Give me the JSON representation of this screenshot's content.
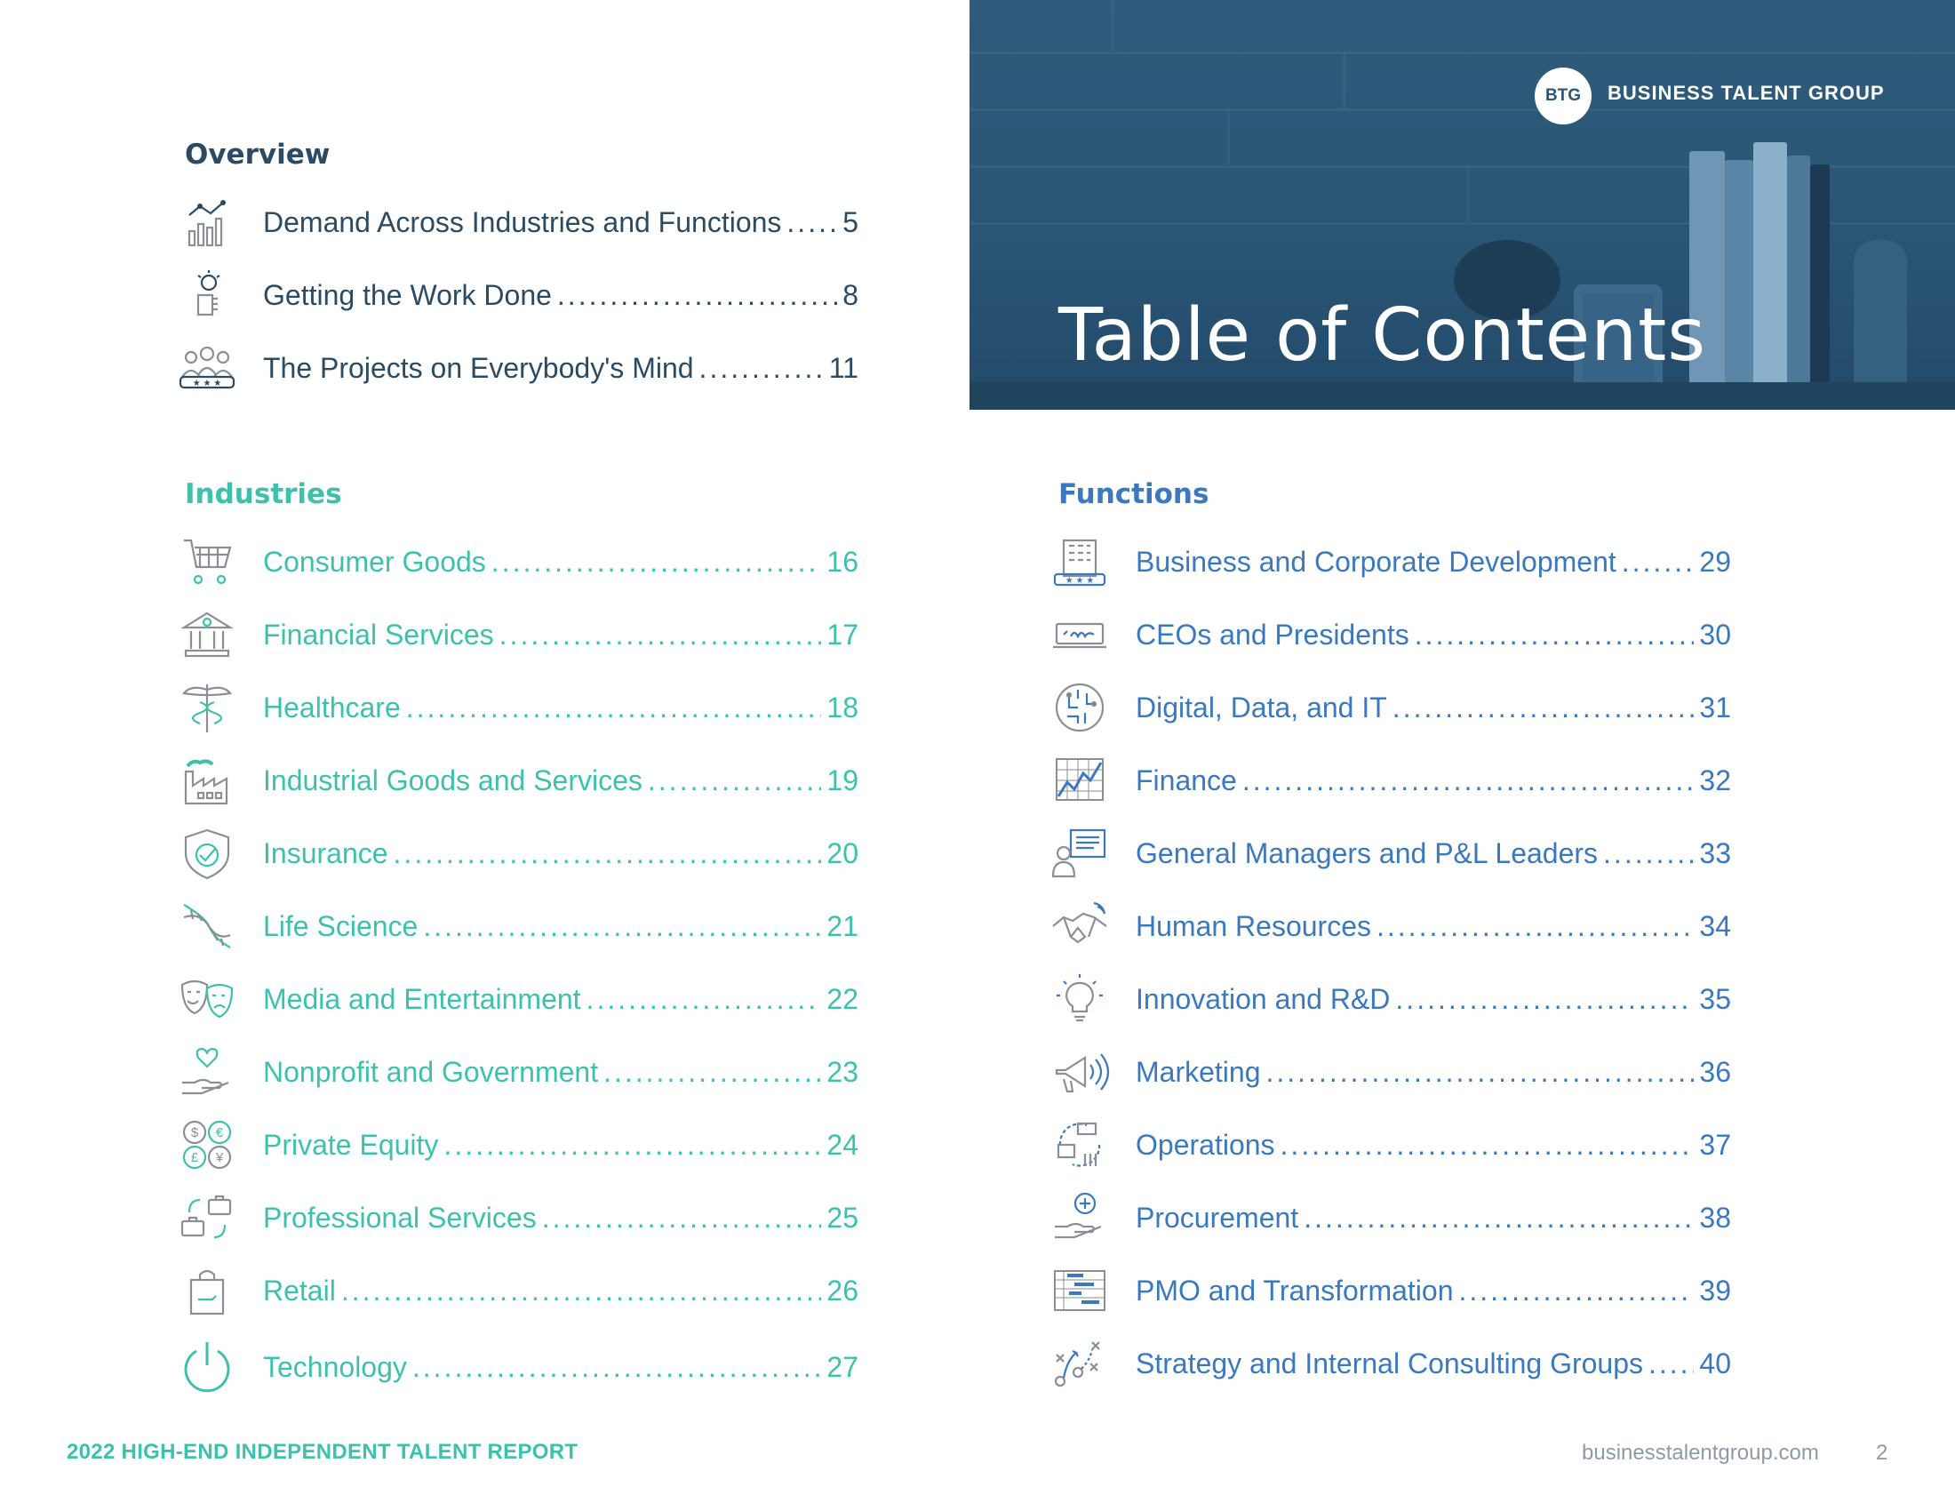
{
  "hero": {
    "title": "Table of Contents",
    "logo_text": "BTG",
    "brand_name": "BUSINESS TALENT GROUP"
  },
  "overview": {
    "heading": "Overview",
    "items": [
      {
        "label": "Demand Across Industries and Functions",
        "page": "5",
        "icon": "chart-trend-icon"
      },
      {
        "label": "Getting the Work Done",
        "page": "8",
        "icon": "hand-lightbulb-icon"
      },
      {
        "label": "The Projects on Everybody's Mind",
        "page": "11",
        "icon": "people-stars-icon"
      }
    ]
  },
  "industries": {
    "heading": "Industries",
    "items": [
      {
        "label": "Consumer Goods",
        "page": "16",
        "icon": "shopping-cart-icon"
      },
      {
        "label": "Financial Services",
        "page": "17",
        "icon": "bank-icon"
      },
      {
        "label": "Healthcare",
        "page": "18",
        "icon": "caduceus-icon"
      },
      {
        "label": "Industrial Goods and Services",
        "page": "19",
        "icon": "factory-icon"
      },
      {
        "label": "Insurance",
        "page": "20",
        "icon": "shield-check-icon"
      },
      {
        "label": "Life Science",
        "page": "21",
        "icon": "dna-icon"
      },
      {
        "label": "Media and Entertainment",
        "page": "22",
        "icon": "theater-masks-icon"
      },
      {
        "label": "Nonprofit and Government",
        "page": "23",
        "icon": "hand-heart-icon"
      },
      {
        "label": "Private Equity",
        "page": "24",
        "icon": "currencies-icon"
      },
      {
        "label": "Professional Services",
        "page": "25",
        "icon": "briefcase-exchange-icon"
      },
      {
        "label": "Retail",
        "page": "26",
        "icon": "shopping-bag-icon"
      },
      {
        "label": "Technology",
        "page": "27",
        "icon": "power-icon"
      }
    ]
  },
  "functions": {
    "heading": "Functions",
    "items": [
      {
        "label": "Business and Corporate Development",
        "page": "29",
        "icon": "building-stars-icon"
      },
      {
        "label": "CEOs and Presidents",
        "page": "30",
        "icon": "signature-icon"
      },
      {
        "label": "Digital, Data, and IT",
        "page": "31",
        "icon": "circuit-brain-icon"
      },
      {
        "label": "Finance",
        "page": "32",
        "icon": "line-chart-icon"
      },
      {
        "label": "General Managers and P&L Leaders",
        "page": "33",
        "icon": "presenter-board-icon"
      },
      {
        "label": "Human Resources",
        "page": "34",
        "icon": "handshake-icon"
      },
      {
        "label": "Innovation and R&D",
        "page": "35",
        "icon": "lightbulb-icon"
      },
      {
        "label": "Marketing",
        "page": "36",
        "icon": "megaphone-icon"
      },
      {
        "label": "Operations",
        "page": "37",
        "icon": "operations-cycle-icon"
      },
      {
        "label": "Procurement",
        "page": "38",
        "icon": "hand-plus-icon"
      },
      {
        "label": "PMO and Transformation",
        "page": "39",
        "icon": "gantt-chart-icon"
      },
      {
        "label": "Strategy and Internal Consulting Groups",
        "page": "40",
        "icon": "strategy-play-icon"
      }
    ]
  },
  "footer": {
    "report_title": "2022 HIGH-END INDEPENDENT TALENT REPORT",
    "url": "businesstalentgroup.com",
    "page_number": "2"
  },
  "colors": {
    "overview": "#2b4a63",
    "industries": "#3dc1ad",
    "functions": "#3a78bf",
    "hero_bg": "#2b5777",
    "icon_gray": "#8a8f96"
  }
}
